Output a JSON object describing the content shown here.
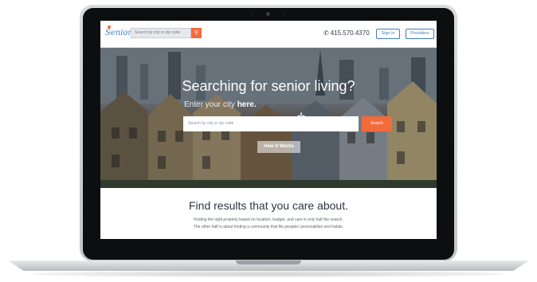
{
  "brand": {
    "logo_text": "Seniorly",
    "accent_color": "#f26b3a",
    "brand_color": "#3f7ec0"
  },
  "nav": {
    "search_placeholder": "Search by city or zip code",
    "search_icon": "search-icon",
    "phone": "415.570.4370",
    "phone_icon": "phone-icon",
    "sign_in_label": "Sign in",
    "providers_label": "Providers"
  },
  "hero": {
    "title": "Searching for senior living?",
    "subtitle_lead": "Enter your city",
    "subtitle_bold": "here.",
    "search_placeholder": "Search by city or zip code",
    "search_button": "Search",
    "how_it_works_label": "How It Works"
  },
  "content": {
    "title": "Find results that you care about.",
    "line1": "Finding the right property based on location, budget, and care is only half the search.",
    "line2": "The other half is about finding a community that fits peoples' personalities and habits."
  }
}
